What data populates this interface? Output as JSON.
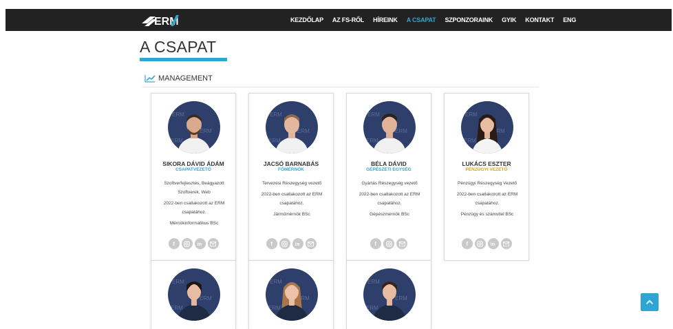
{
  "brand": {
    "logo_text": "ERM",
    "accent_color": "#2ea6d3"
  },
  "nav": {
    "items": [
      "KEZDŐLAP",
      "AZ FS-RŐL",
      "HÍREINK",
      "A CSAPAT",
      "SZPONZORAINK",
      "GYIK",
      "KONTAKT",
      "ENG"
    ],
    "active": "A CSAPAT"
  },
  "page": {
    "title": "A CSAPAT"
  },
  "section": {
    "label": "MANAGEMENT",
    "icon": "chart-line-icon"
  },
  "members": [
    {
      "name": "SIKORA DÁVID ÁDÁM",
      "role": "CSAPATVEZETŐ",
      "role_color": "#2ea6d3",
      "desc": [
        "Szoftverfejlesztés, Beágyazott Szoftverek, Web",
        "2022-ben csatlakozott az ERM csapatához.",
        "Mérnökinformatikus BSc"
      ],
      "socials": [
        "facebook-icon",
        "instagram-icon",
        "linkedin-icon",
        "email-icon"
      ]
    },
    {
      "name": "JACSÓ BARNABÁS",
      "role": "FŐMÉRNÖK",
      "role_color": "#2ea6d3",
      "desc": [
        "Tervezési Részegység vezető",
        "2022-ben csatlakozott az ERM csapatához.",
        "Járműmérnök BSc"
      ],
      "socials": [
        "facebook-icon",
        "instagram-icon",
        "linkedin-icon",
        "email-icon"
      ]
    },
    {
      "name": "BÉLA DÁVID",
      "role": "GÉPÉSZETI EGYSÉG",
      "role_color": "#2ea6d3",
      "desc": [
        "Gyártás Részegység vezető",
        "2022-ben csatlakozott az ERM csapatához.",
        "Gépészmérnök BSc"
      ],
      "socials": [
        "facebook-icon",
        "instagram-icon",
        "email-icon"
      ]
    },
    {
      "name": "LUKÁCS ESZTER",
      "role": "PÉNZÜGYI VEZETŐ",
      "role_color": "#d4a017",
      "desc": [
        "Pénzügyi Részegység Vezető",
        "2022-ben csatlakozott az ERM csapatához.",
        "Pénzügy és számvitel BSc"
      ],
      "socials": [
        "facebook-icon",
        "instagram-icon",
        "linkedin-icon",
        "email-icon"
      ]
    }
  ]
}
